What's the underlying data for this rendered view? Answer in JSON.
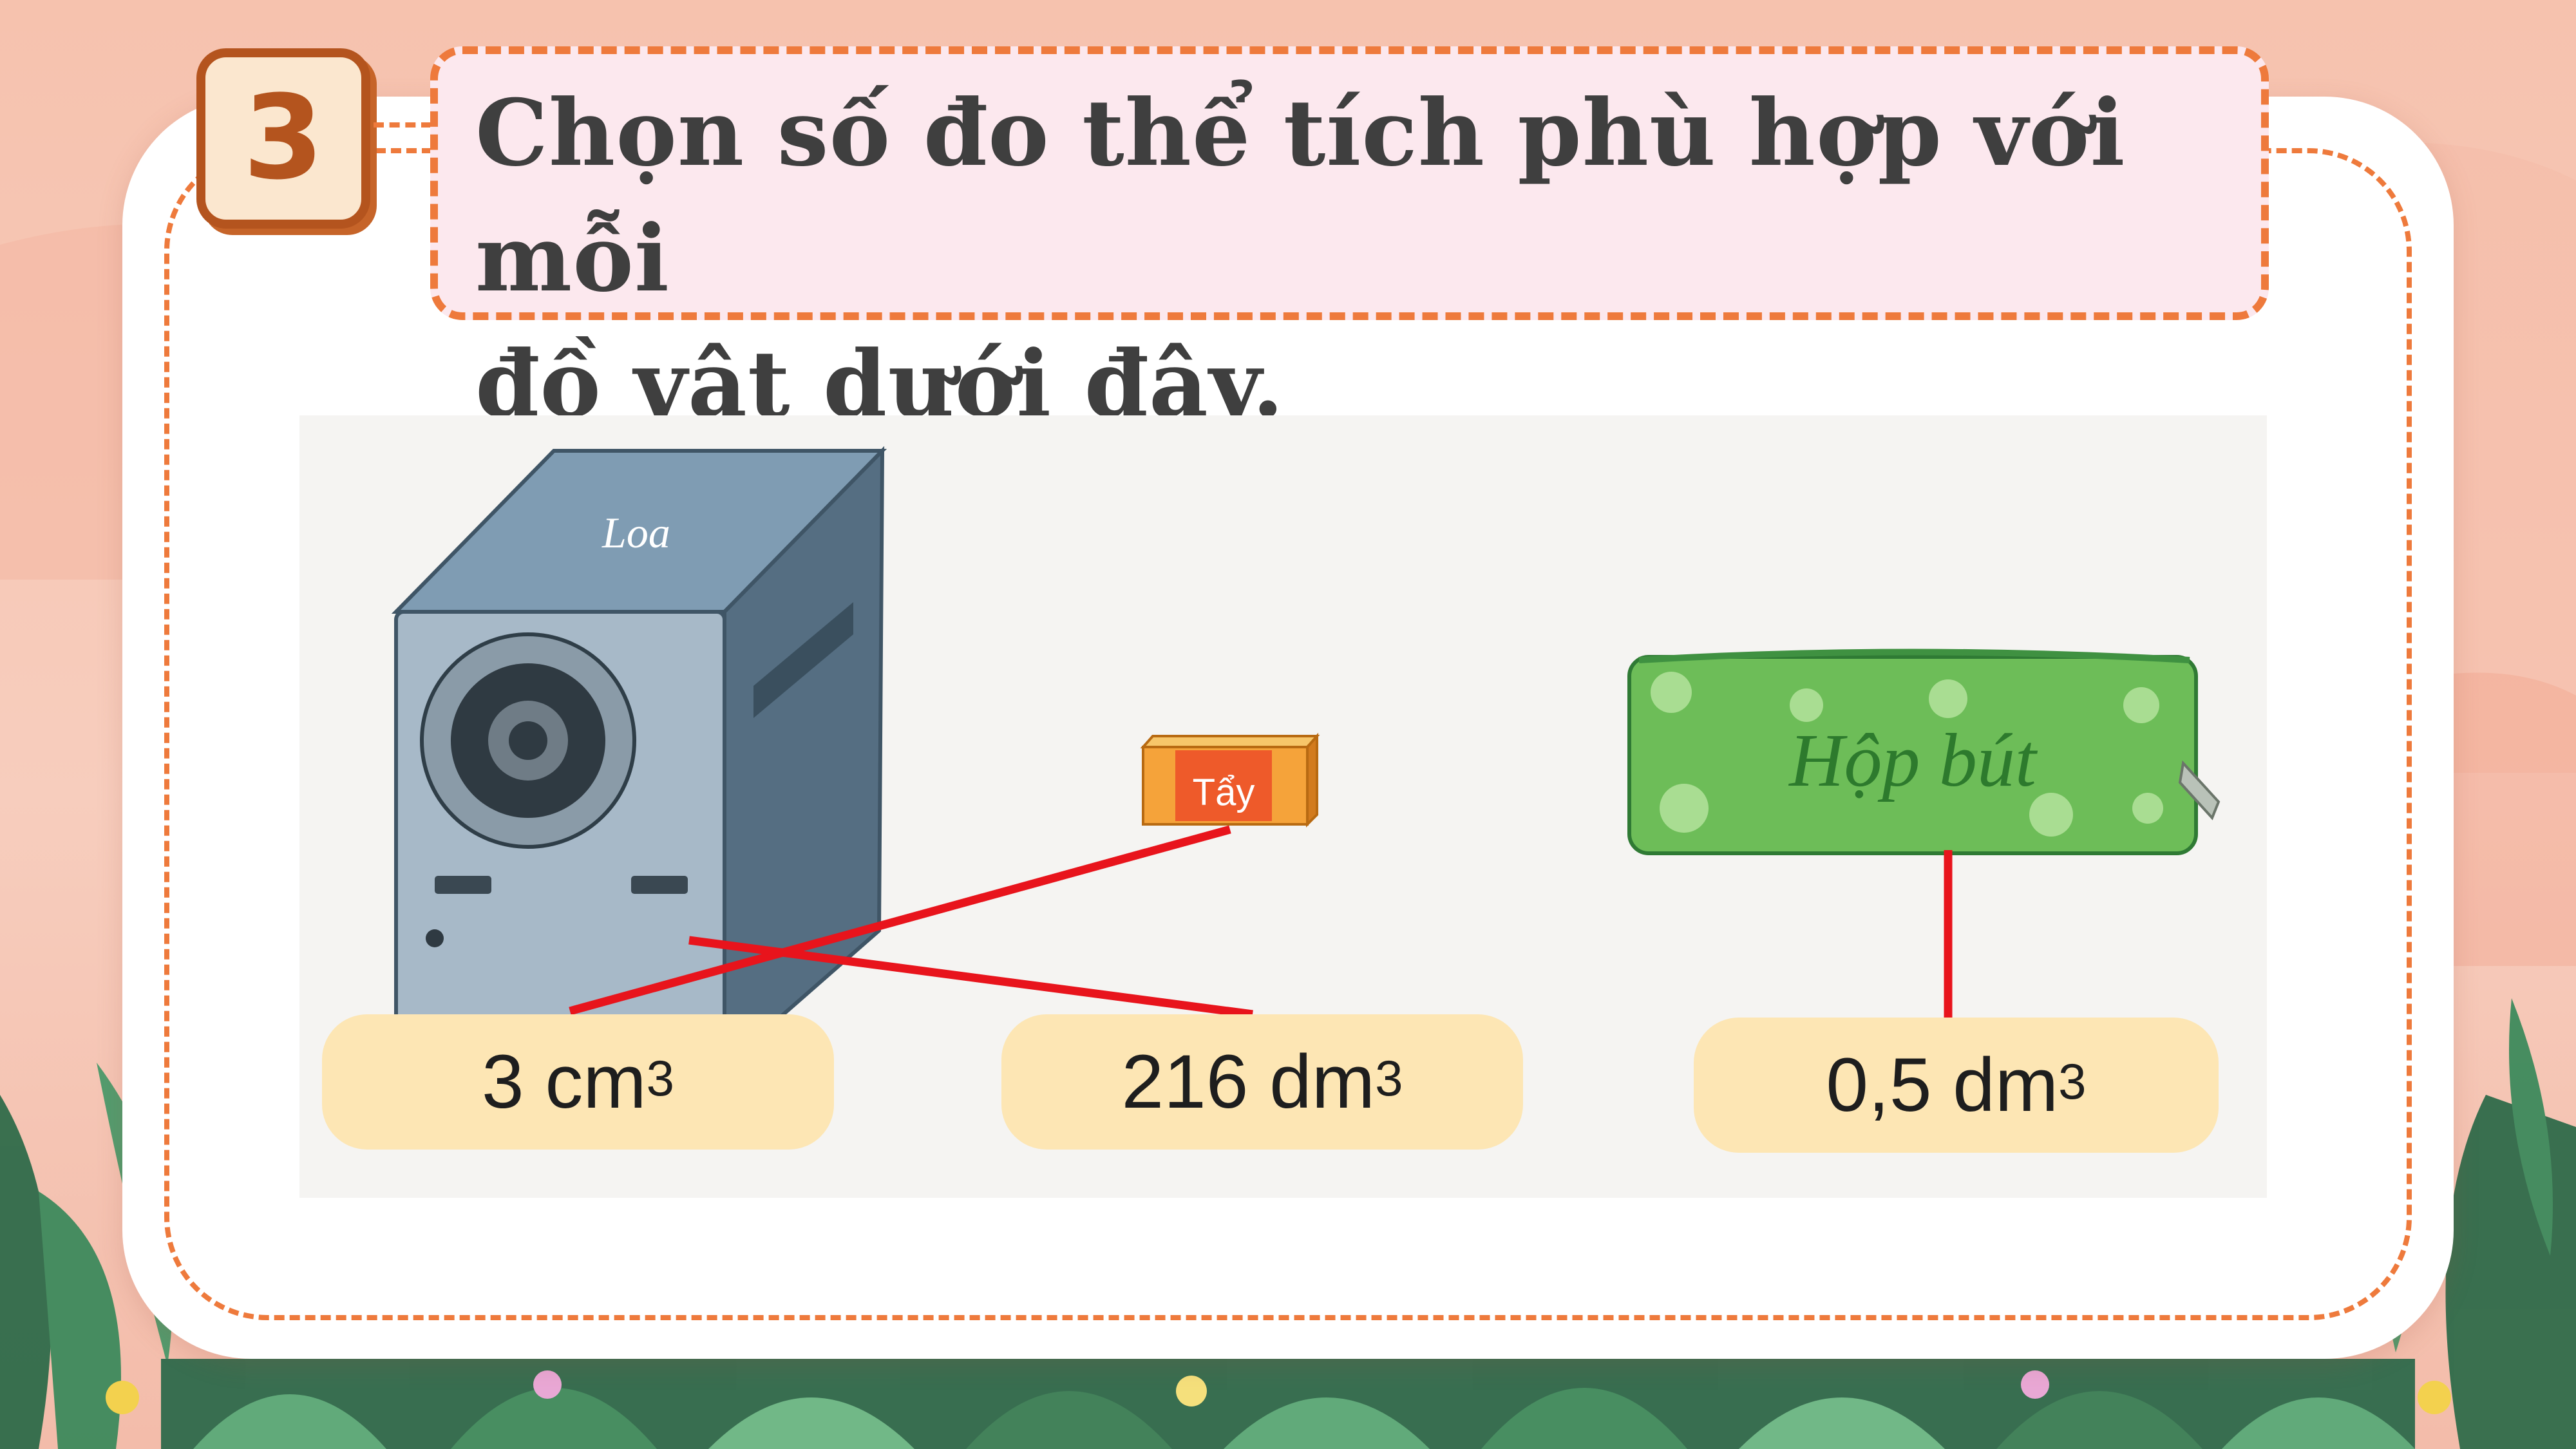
{
  "question": {
    "number": "3",
    "title_line1": "Chọn số đo thể tích phù hợp với mỗi",
    "title_line2": "đồ vật dưới đây."
  },
  "objects": {
    "speaker_label": "Loa",
    "eraser_label": "Tẩy",
    "pencil_case_label": "Hộp bút"
  },
  "answers": [
    {
      "value": "3 cm",
      "exp": "3"
    },
    {
      "value": "216 dm",
      "exp": "3"
    },
    {
      "value": "0,5 dm",
      "exp": "3"
    }
  ],
  "colors": {
    "accent_orange": "#ee7a3c",
    "badge_brown": "#b4541e",
    "answer_bg": "#fde6b4",
    "match_line": "#e8141c"
  }
}
